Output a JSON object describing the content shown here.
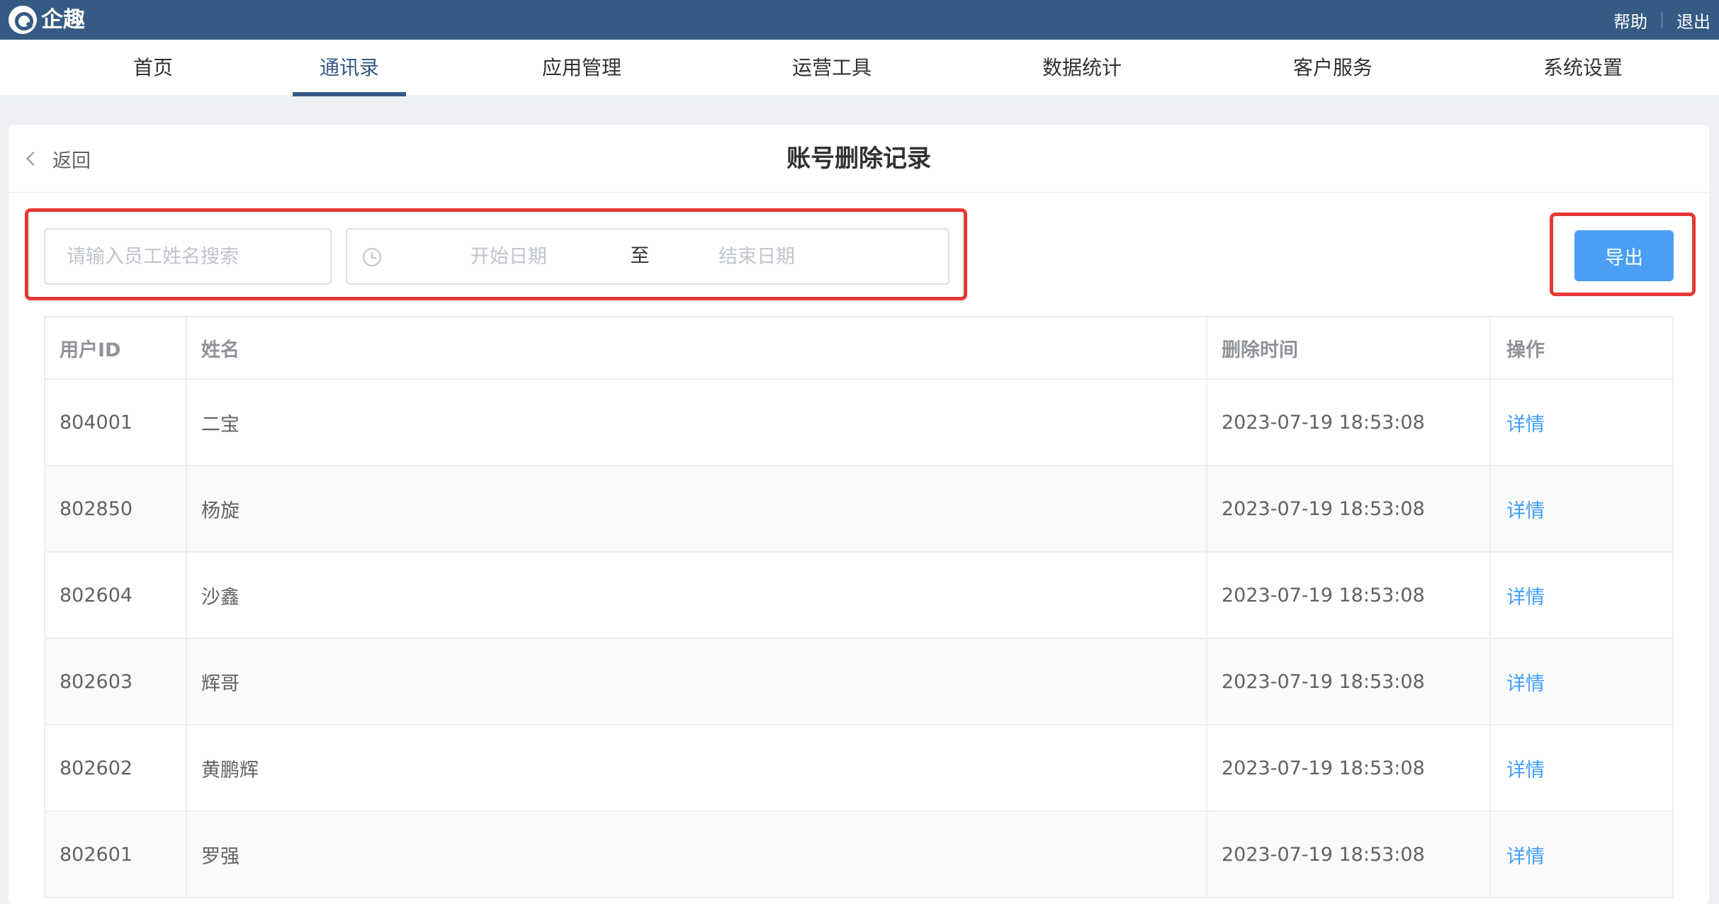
{
  "app": {
    "brand": "企趣",
    "links": {
      "help": "帮助",
      "logout": "退出"
    },
    "colors": {
      "header_bg": "#355a84",
      "accent": "#409eff",
      "highlight": "#e53935"
    }
  },
  "nav": {
    "tabs": [
      {
        "label": "首页"
      },
      {
        "label": "通讯录",
        "active": true
      },
      {
        "label": "应用管理"
      },
      {
        "label": "运营工具"
      },
      {
        "label": "数据统计"
      },
      {
        "label": "客户服务"
      },
      {
        "label": "系统设置"
      }
    ]
  },
  "page": {
    "back_label": "返回",
    "title": "账号删除记录"
  },
  "filters": {
    "search_placeholder": "请输入员工姓名搜索",
    "start_placeholder": "开始日期",
    "separator": "至",
    "end_placeholder": "结束日期",
    "export_label": "导出"
  },
  "table": {
    "columns": [
      "用户ID",
      "姓名",
      "删除时间",
      "操作"
    ],
    "action_label": "详情",
    "rows": [
      {
        "id": "804001",
        "name": "二宝",
        "time": "2023-07-19 18:53:08"
      },
      {
        "id": "802850",
        "name": "杨旋",
        "time": "2023-07-19 18:53:08"
      },
      {
        "id": "802604",
        "name": "沙鑫",
        "time": "2023-07-19 18:53:08"
      },
      {
        "id": "802603",
        "name": "辉哥",
        "time": "2023-07-19 18:53:08"
      },
      {
        "id": "802602",
        "name": "黄鹏辉",
        "time": "2023-07-19 18:53:08"
      },
      {
        "id": "802601",
        "name": "罗强",
        "time": "2023-07-19 18:53:08"
      }
    ]
  }
}
